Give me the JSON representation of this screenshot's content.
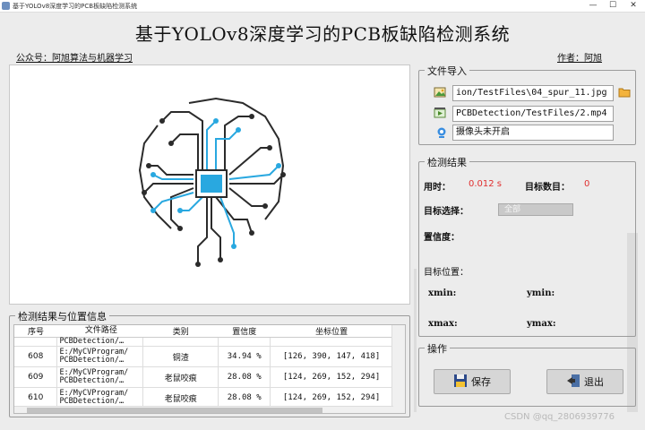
{
  "window": {
    "title": "基于YOLOv8深度学习的PCB板缺陷检测系统",
    "minimize": "—",
    "maximize": "☐",
    "close": "✕"
  },
  "header": {
    "title": "基于YOLOv8深度学习的PCB板缺陷检测系统",
    "public_account": "公众号：阿旭算法与机器学习",
    "author": "作者：阿旭"
  },
  "file_import": {
    "title": "文件导入",
    "image_path": "ion/TestFiles\\04_spur_11.jpg",
    "video_path": "PCBDetection/TestFiles/2.mp4",
    "camera_status": "摄像头未开启"
  },
  "results": {
    "title": "检测结果",
    "time_label": "用时：",
    "time_value": "0.012 s",
    "count_label": "目标数目：",
    "count_value": "0",
    "target_select_label": "目标选择：",
    "target_select_value": "全部",
    "confidence_label": "置信度：",
    "position_label": "目标位置：",
    "xmin_label": "xmin:",
    "ymin_label": "ymin:",
    "xmax_label": "xmax:",
    "ymax_label": "ymax:"
  },
  "operations": {
    "title": "操作",
    "save_label": "保存",
    "exit_label": "退出"
  },
  "table": {
    "title": "检测结果与位置信息",
    "headers": [
      "序号",
      "文件路径",
      "类别",
      "置信度",
      "坐标位置"
    ],
    "partial_row": {
      "path": "PCBDetection/…"
    },
    "rows": [
      {
        "idx": "608",
        "path1": "E:/MyCVProgram/",
        "path2": "PCBDetection/…",
        "cls": "铜渣",
        "conf": "34.94 %",
        "box": "[126, 390, 147, 418]"
      },
      {
        "idx": "609",
        "path1": "E:/MyCVProgram/",
        "path2": "PCBDetection/…",
        "cls": "老鼠咬痕",
        "conf": "28.08 %",
        "box": "[124, 269, 152, 294]"
      },
      {
        "idx": "610",
        "path1": "E:/MyCVProgram/",
        "path2": "PCBDetection/…",
        "cls": "老鼠咬痕",
        "conf": "28.08 %",
        "box": "[124, 269, 152, 294]"
      }
    ]
  },
  "watermark": "CSDN @qq_2806939776",
  "colors": {
    "accent_value": "#e03030",
    "chip_blue": "#29a8e0",
    "circuit_dark": "#2b2b2b"
  },
  "icons": {
    "image_file": "image-icon",
    "video_file": "video-icon",
    "camera": "camera-icon",
    "folder": "folder-icon",
    "save": "save-icon",
    "exit": "exit-icon",
    "logo": "brain-circuit-logo"
  }
}
